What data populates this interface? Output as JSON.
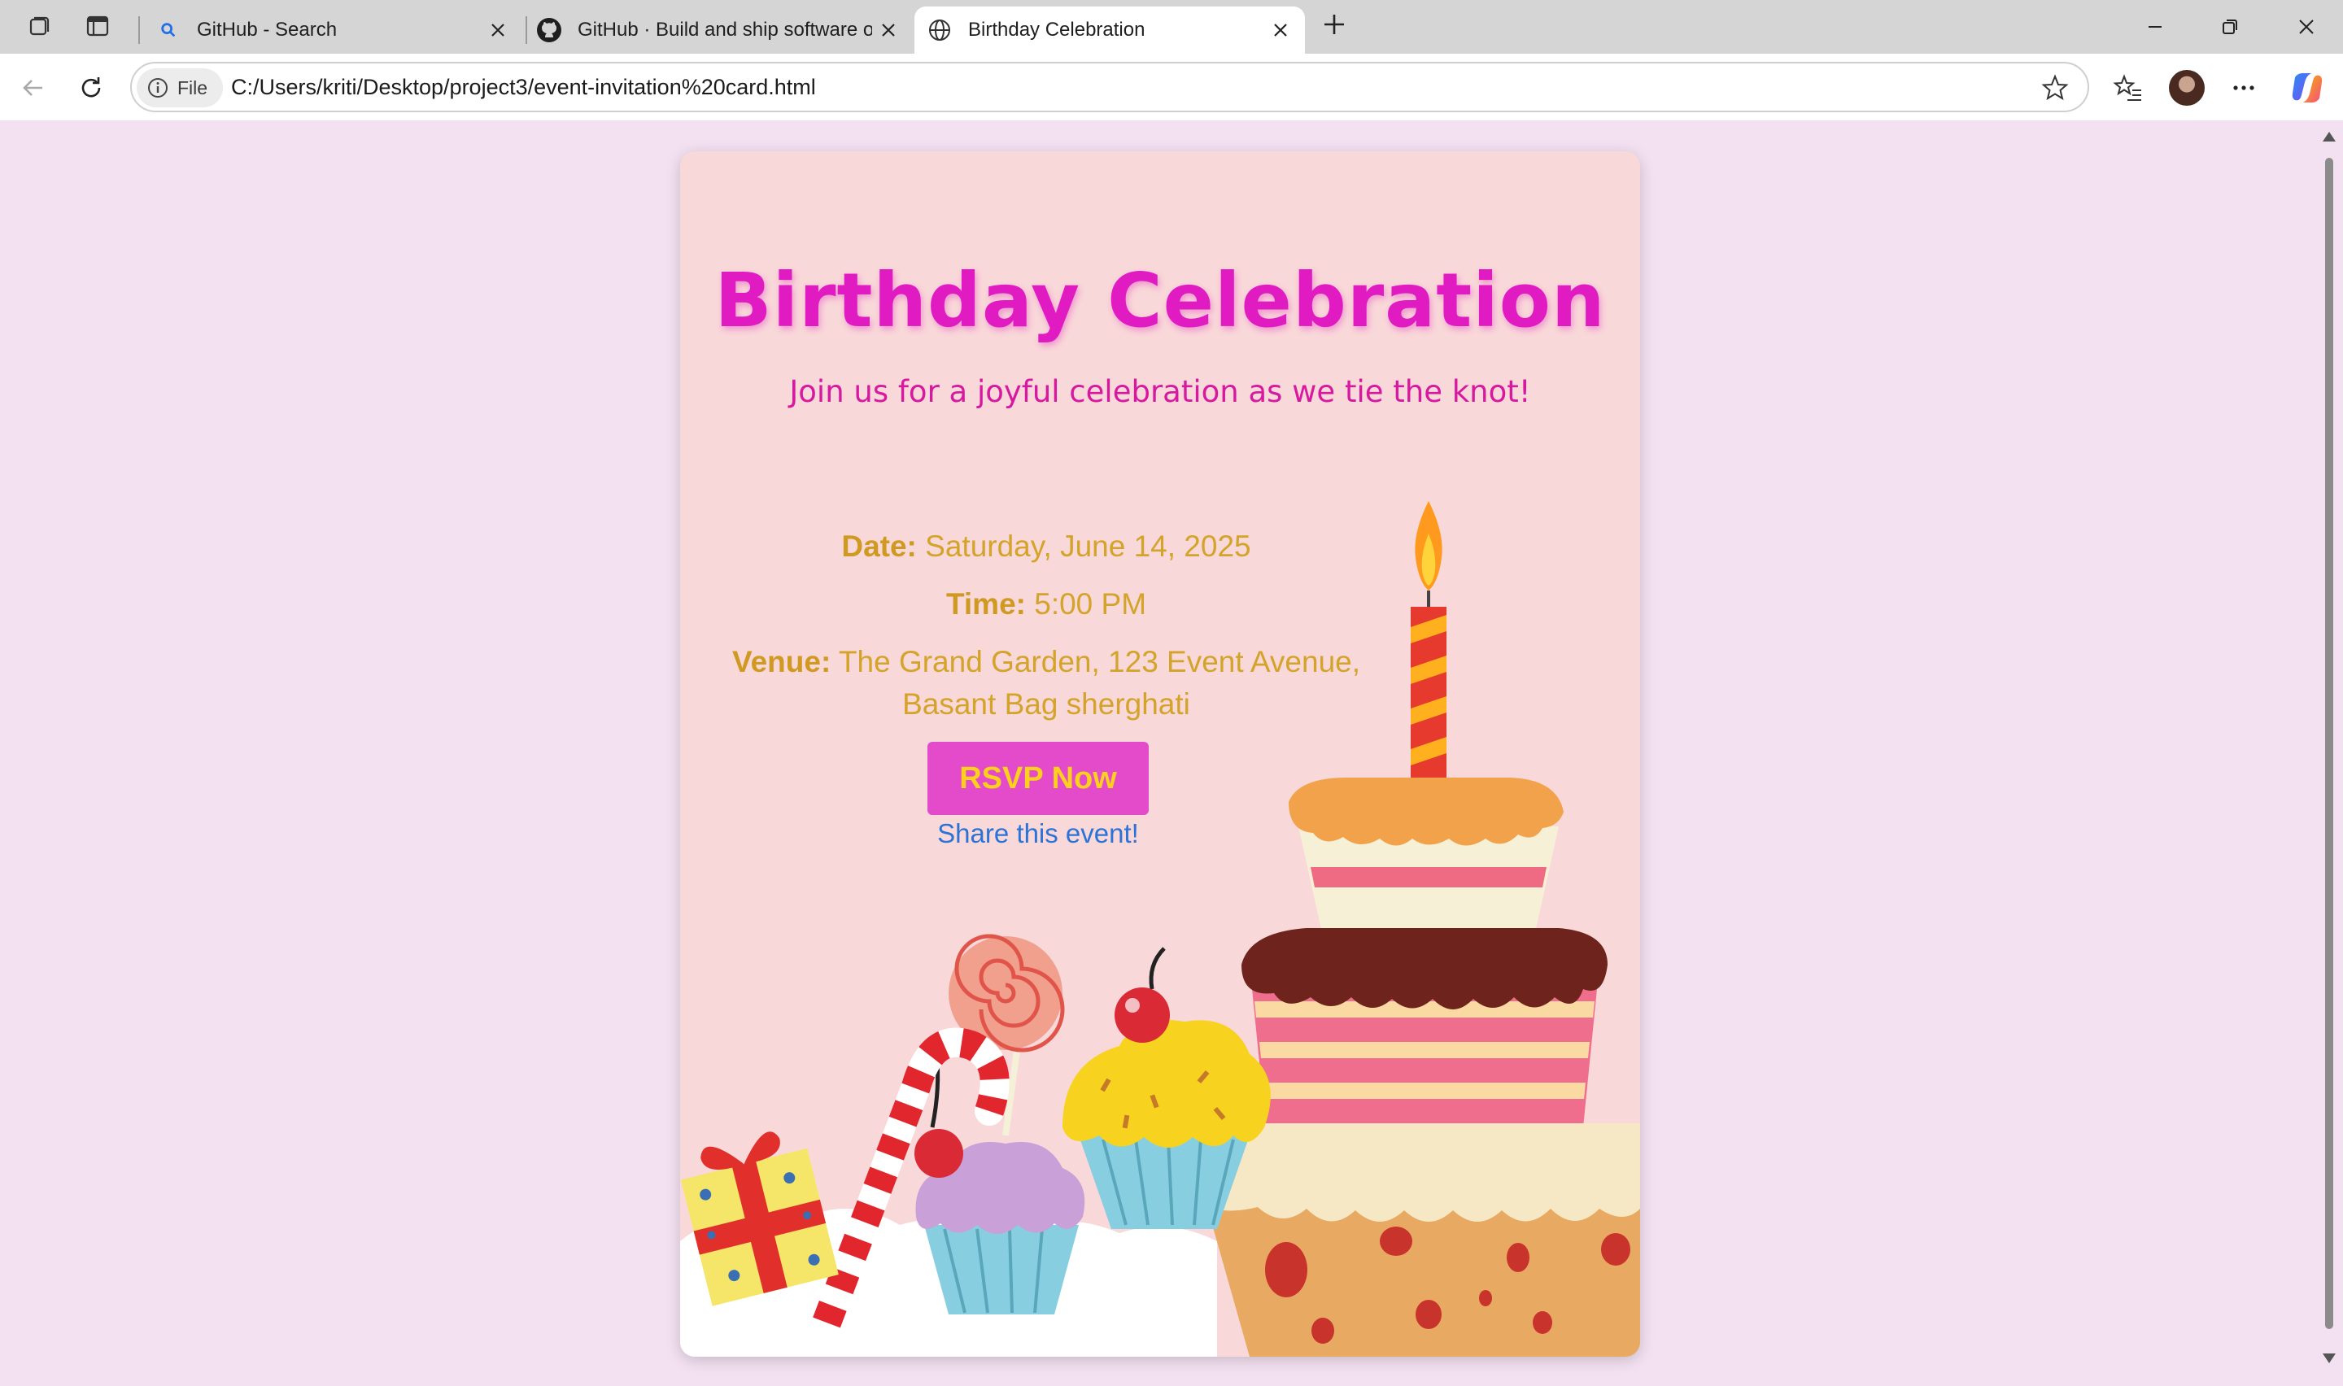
{
  "browser": {
    "tabs": [
      {
        "title": "GitHub - Search",
        "icon": "search-icon"
      },
      {
        "title": "GitHub · Build and ship software on",
        "icon": "github-icon"
      },
      {
        "title": "Birthday Celebration",
        "icon": "globe-icon",
        "active": true
      }
    ],
    "new_tab_label": "+",
    "address": {
      "chip_label": "File",
      "url": "C:/Users/kriti/Desktop/project3/event-invitation%20card.html"
    }
  },
  "card": {
    "title": "Birthday Celebration",
    "subtitle": "Join us for a joyful celebration as we tie the knot!",
    "date_label": "Date:",
    "date_value": "Saturday, June 14, 2025",
    "time_label": "Time:",
    "time_value": "5:00 PM",
    "venue_label": "Venue:",
    "venue_line1": "The Grand Garden, 123 Event Avenue,",
    "venue_line2": "Basant Bag sherghati",
    "rsvp_label": "RSVP Now",
    "share_label": "Share this event!"
  },
  "colors": {
    "page_bg": "#f3e1f1",
    "card_bg": "#f9d8d9",
    "title": "#e01bc1",
    "details": "#d4a329",
    "rsvp_bg": "#e34bcb",
    "rsvp_text": "#ffd01c",
    "link": "#2b73d6"
  }
}
